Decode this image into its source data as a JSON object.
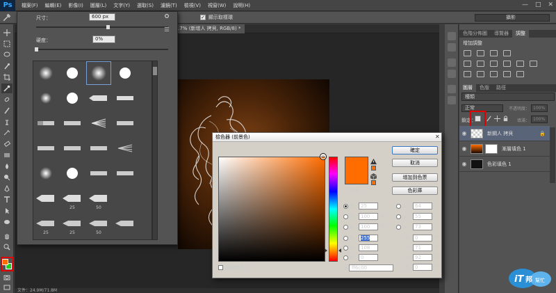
{
  "app": {
    "logo": "Ps"
  },
  "menu": [
    "檔案(F)",
    "編輯(E)",
    "影像(I)",
    "圖層(L)",
    "文字(Y)",
    "選取(S)",
    "濾鏡(T)",
    "檢視(V)",
    "視窗(W)",
    "說明(H)"
  ],
  "window_controls": [
    "—",
    "□",
    "✕"
  ],
  "options_bar": {
    "show_transform_label": "顯示取樣環",
    "workspace": "攝影"
  },
  "document_tab": "@ 16.7% (新增人 拷貝, RGB/8) *",
  "status_bar": "文件：24.9M/71.8M",
  "brush_panel": {
    "size_label": "尺寸：",
    "size_value": "600 px",
    "hardness_label": "硬度：",
    "hardness_value": "0%",
    "numbers": [
      "25",
      "50",
      "25",
      "25",
      "50"
    ]
  },
  "panels": {
    "top_tabs": [
      "色階分佈圖",
      "導覽器",
      "調整"
    ],
    "adjust_title": "增加調整",
    "layer_tabs": [
      "圖層",
      "色版",
      "路徑"
    ],
    "filter_label": "種類",
    "blend_mode": "正常",
    "opacity_label": "不透明度：",
    "opacity_value": "100%",
    "lock_label": "鎖定：",
    "fill_label": "填滿：",
    "fill_value": "100%",
    "layers": [
      {
        "name": "新鋼人 拷貝",
        "selected": true
      },
      {
        "name": "漸層填色 1",
        "selected": false
      },
      {
        "name": "色彩填色 1",
        "selected": false
      }
    ]
  },
  "color_picker": {
    "title": "檢色器 (前景色)",
    "new_label": "新的",
    "current_label": "目前",
    "buttons": {
      "ok": "確定",
      "cancel": "取消",
      "add_swatch": "增加到色票",
      "libraries": "色彩庫"
    },
    "hsb": {
      "h_label": "H:",
      "h": "25",
      "h_unit": "°",
      "s_label": "S:",
      "s": "100",
      "s_unit": "%",
      "b_label": "B:",
      "b": "100",
      "b_unit": "%"
    },
    "rgb": {
      "r_label": "R:",
      "r": "255",
      "g_label": "G:",
      "g": "108",
      "b_label": "B:",
      "b": "0"
    },
    "lab": {
      "l_label": "L:",
      "l": "64",
      "a_label": "a:",
      "a": "55",
      "b_label": "b:",
      "b": "73"
    },
    "cmyk": {
      "c_label": "C:",
      "c": "0",
      "c_unit": "%",
      "m_label": "M:",
      "m": "71",
      "m_unit": "%",
      "y_label": "Y:",
      "y": "92",
      "y_unit": "%",
      "k_label": "K:",
      "k": "0",
      "k_unit": "%"
    },
    "hex_label": "#",
    "hex": "ff6c00",
    "web_only_label": "僅網頁色彩",
    "color": "#ff6c00"
  },
  "colors": {
    "foreground": "#ff6c00",
    "background": "#1fd01f",
    "highlight": "#e00000"
  }
}
